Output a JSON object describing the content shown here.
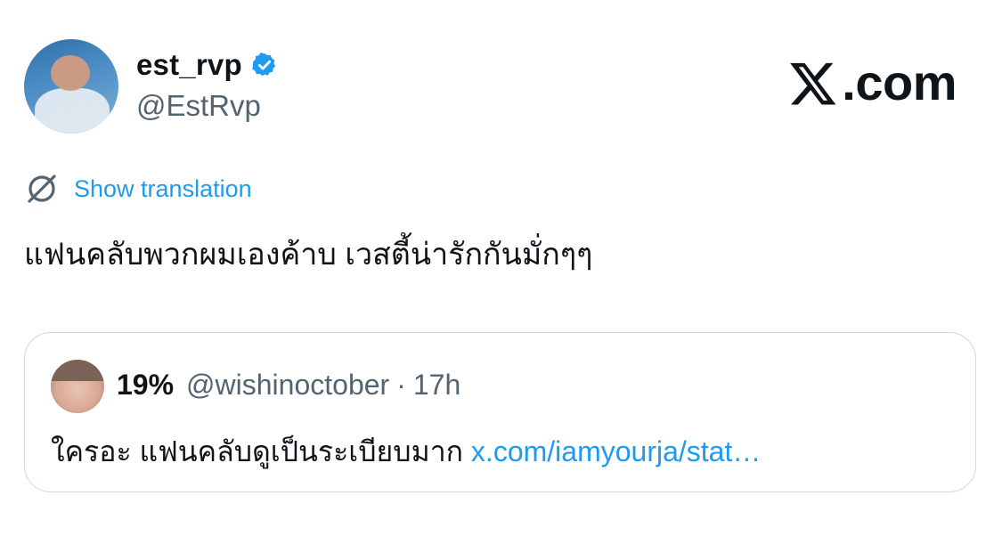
{
  "author": {
    "display_name": "est_rvp",
    "handle": "@EstRvp",
    "verified": true
  },
  "brand": {
    "label": ".com"
  },
  "translate": {
    "label": "Show translation"
  },
  "tweet": {
    "text": "แฟนคลับพวกผมเองค้าบ เวสตี้น่ารักกันมั่กๆๆ"
  },
  "quoted_tweet": {
    "display_name": "19%",
    "handle": "@wishinoctober",
    "separator": "·",
    "time": "17h",
    "text": "ใครอะ แฟนคลับดูเป็นระเบียบมาก ",
    "link": "x.com/iamyourja/stat…"
  },
  "colors": {
    "accent": "#1d9bf0",
    "secondary_text": "#536471",
    "border": "#cfd9de"
  }
}
